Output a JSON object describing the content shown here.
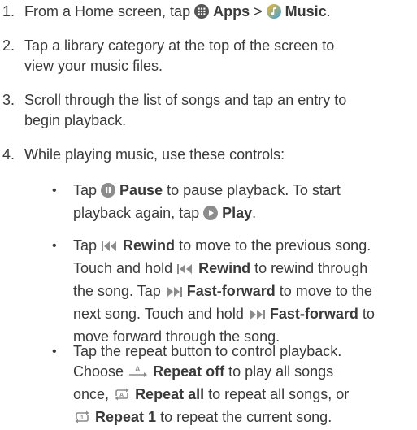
{
  "steps": [
    {
      "num": "1.",
      "t1": "From a Home screen, tap ",
      "apps": "Apps",
      "sep": " > ",
      "music": "Music",
      "end": "."
    },
    {
      "num": "2.",
      "l1": "Tap a library category at the top of the screen to",
      "l2": "view your music files."
    },
    {
      "num": "3.",
      "l1": "Scroll through the list of songs and tap an entry to",
      "l2": "begin playback."
    },
    {
      "num": "4.",
      "l1": "While playing music, use these controls:"
    }
  ],
  "bullets": {
    "b1": {
      "tap": "Tap ",
      "pause": "Pause",
      "mid": " to pause playback. To start",
      "l2a": "playback again, tap ",
      "play": "Play",
      "end": "."
    },
    "b2": {
      "tap": "Tap ",
      "rewind": "Rewind",
      "r1": " to move to the previous song.",
      "l2a": "Touch and hold ",
      "rewind2": "Rewind",
      "r2": " to rewind through",
      "l3a": "the song. Tap ",
      "ff": "Fast-forward",
      "r3": " to move to the",
      "l4a": "next song. Touch and hold ",
      "ff2": "Fast-forward",
      "r4": " to",
      "l5": "move forward through the song."
    },
    "b3": {
      "l1": "Tap the repeat button to control playback.",
      "l2a": "Choose ",
      "roff": "Repeat off",
      "l2b": " to play all songs",
      "l3a": "once, ",
      "rall": "Repeat all",
      "l3b": " to repeat all songs, or",
      "r1": "Repeat 1",
      "l4b": " to repeat the current song."
    }
  },
  "bullet_char": "•",
  "icons": {
    "apps": "apps-grid-icon",
    "music": "music-note-icon",
    "pause": "pause-icon",
    "play": "play-icon",
    "rewind": "rewind-icon",
    "ff": "fast-forward-icon",
    "repeat_off": "repeat-off-icon",
    "repeat_all": "repeat-all-icon",
    "repeat_one": "repeat-one-icon"
  },
  "colors": {
    "text": "#3a3a3a",
    "icon_gray": "#8c8c8c",
    "music_orange": "#f0a020",
    "music_blue": "#3aa0e0"
  }
}
